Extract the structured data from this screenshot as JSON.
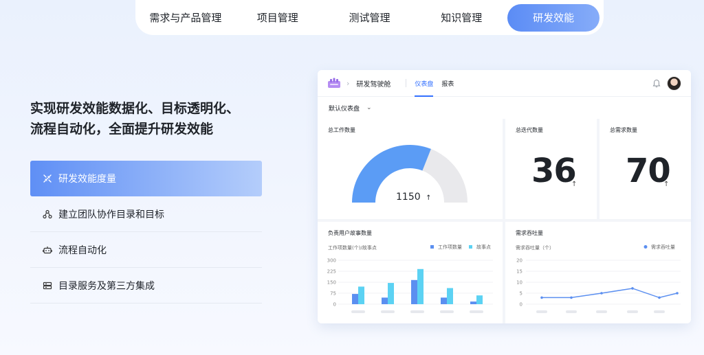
{
  "nav": {
    "tabs": [
      "需求与产品管理",
      "项目管理",
      "测试管理",
      "知识管理",
      "研发效能"
    ],
    "active_index": 4
  },
  "headline": {
    "line1": "实现研发效能数据化、目标透明化、",
    "line2": "流程自动化，全面提升研发效能"
  },
  "features": [
    {
      "label": "研发效能度量",
      "icon": "measure-icon",
      "active": true
    },
    {
      "label": "建立团队协作目录和目标",
      "icon": "team-icon",
      "active": false
    },
    {
      "label": "流程自动化",
      "icon": "robot-icon",
      "active": false
    },
    {
      "label": "目录服务及第三方集成",
      "icon": "integration-icon",
      "active": false
    }
  ],
  "dashboard": {
    "title": "研发驾驶舱",
    "tabs": [
      "仪表盘",
      "报表"
    ],
    "active_tab": 0,
    "dropdown": "默认仪表盘",
    "total_work": {
      "title": "总工作数量",
      "value": "1150",
      "arrow": "↑",
      "fill_fraction": 0.62
    },
    "total_iter": {
      "title": "总迭代数量",
      "value": "36",
      "arrow": "↑"
    },
    "total_req": {
      "title": "总需求数量",
      "value": "70",
      "arrow": "↑"
    },
    "colors": {
      "accent": "#3370ff",
      "gauge": "#5b9cf5",
      "gauge_track": "#e9e9ec",
      "bar1": "#5b8ff0",
      "bar2": "#5cd2f3",
      "line": "#5b8ff0"
    }
  },
  "chart_data": [
    {
      "type": "bar",
      "title": "负责用户故事数量",
      "ylabel": "工作项数量(个)/故事点",
      "yticks": [
        "300",
        "225",
        "150",
        "75",
        "0"
      ],
      "ylim": [
        0,
        300
      ],
      "categories": [
        "",
        "",
        "",
        "",
        ""
      ],
      "series": [
        {
          "name": "工作项数量",
          "values": [
            70,
            45,
            165,
            45,
            18
          ]
        },
        {
          "name": "故事点",
          "values": [
            120,
            145,
            240,
            110,
            60
          ]
        }
      ]
    },
    {
      "type": "line",
      "title": "需求吞吐量",
      "ylabel": "需求吞吐量（个）",
      "yticks": [
        "20",
        "15",
        "10",
        "5",
        "0"
      ],
      "ylim": [
        0,
        20
      ],
      "x": [
        "",
        "",
        "",
        "",
        "",
        ""
      ],
      "series": [
        {
          "name": "需求吞吐量",
          "values": [
            3,
            3,
            5,
            7.2,
            3,
            5
          ]
        }
      ]
    }
  ]
}
